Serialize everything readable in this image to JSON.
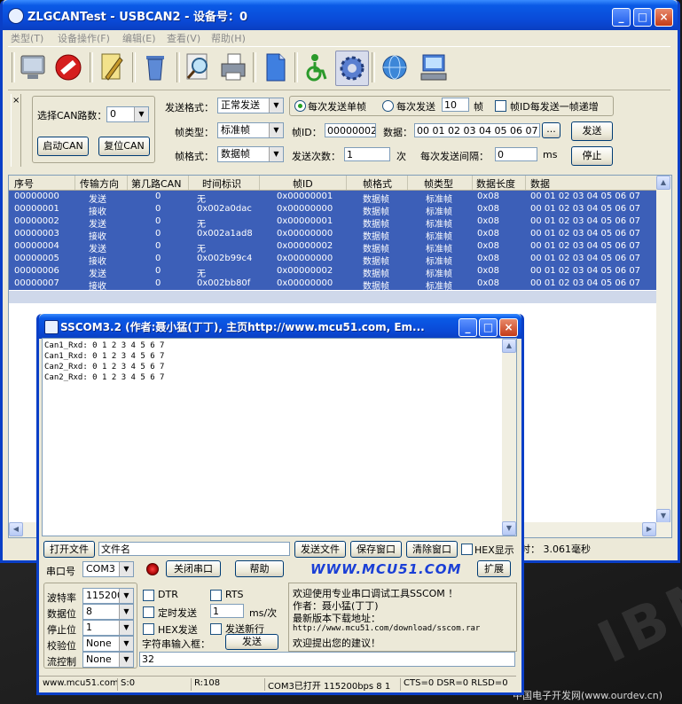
{
  "main_window": {
    "title": "ZLGCANTest - USBCAN2 - 设备号：0",
    "menu": [
      "类型(T)",
      "设备操作(F)",
      "编辑(E)",
      "查看(V)",
      "帮助(H)"
    ],
    "toolbar_icons": [
      "monitor-icon",
      "stop-icon",
      "pencil-icon",
      "trash-icon",
      "search-icon",
      "printer-icon",
      "document-icon",
      "accessibility-icon",
      "gear-icon",
      "globe-icon",
      "computer-icon"
    ],
    "panel": {
      "pin_label": "×",
      "channel_label": "选择CAN路数：",
      "channel_value": "0",
      "start_can": "启动CAN",
      "reset_can": "复位CAN",
      "send_format_label": "发送格式：",
      "send_format_value": "正常发送",
      "send_single_label": "每次发送单帧",
      "send_multi_label": "每次发送",
      "multi_count": "10",
      "frame_unit": "帧",
      "inc_id_label": "帧ID每发送一帧递增",
      "frame_type_label": "帧类型：",
      "frame_type_value": "标准帧",
      "frame_id_label": "帧ID：",
      "frame_id_value": "00000002",
      "data_label": "数据：",
      "data_value": "00 01 02 03 04 05 06 07",
      "ellipsis": "...",
      "send_button": "发送",
      "frame_format_label": "帧格式：",
      "frame_format_value": "数据帧",
      "send_count_label": "发送次数：",
      "send_count_value": "1",
      "times_unit": "次",
      "interval_label": "每次发送间隔：",
      "interval_value": "0",
      "ms_unit": "ms",
      "stop_button": "停止"
    },
    "grid": {
      "headers": [
        "序号",
        "传输方向",
        "第几路CAN",
        "时间标识",
        "帧ID",
        "帧格式",
        "帧类型",
        "数据长度",
        "数据"
      ],
      "rows": [
        [
          "00000000",
          "发送",
          "0",
          "无",
          "0x00000001",
          "数据帧",
          "标准帧",
          "0x08",
          "00 01 02 03 04 05 06 07"
        ],
        [
          "00000001",
          "接收",
          "0",
          "0x002a0dac",
          "0x00000000",
          "数据帧",
          "标准帧",
          "0x08",
          "00 01 02 03 04 05 06 07"
        ],
        [
          "00000002",
          "发送",
          "0",
          "无",
          "0x00000001",
          "数据帧",
          "标准帧",
          "0x08",
          "00 01 02 03 04 05 06 07"
        ],
        [
          "00000003",
          "接收",
          "0",
          "0x002a1ad8",
          "0x00000000",
          "数据帧",
          "标准帧",
          "0x08",
          "00 01 02 03 04 05 06 07"
        ],
        [
          "00000004",
          "发送",
          "0",
          "无",
          "0x00000002",
          "数据帧",
          "标准帧",
          "0x08",
          "00 01 02 03 04 05 06 07"
        ],
        [
          "00000005",
          "接收",
          "0",
          "0x002b99c4",
          "0x00000000",
          "数据帧",
          "标准帧",
          "0x08",
          "00 01 02 03 04 05 06 07"
        ],
        [
          "00000006",
          "发送",
          "0",
          "无",
          "0x00000002",
          "数据帧",
          "标准帧",
          "0x08",
          "00 01 02 03 04 05 06 07"
        ],
        [
          "00000007",
          "接收",
          "0",
          "0x002bb80f",
          "0x00000000",
          "数据帧",
          "标准帧",
          "0x08",
          "00 01 02 03 04 05 06 07"
        ]
      ]
    },
    "status_time": "时：  3.061毫秒"
  },
  "sscom": {
    "title": "SSCOM3.2 (作者:聂小猛(丁丁), 主页http://www.mcu51.com, Em...",
    "terminal_lines": [
      "Can1_Rxd: 0 1 2 3 4 5 6 7",
      "Can1_Rxd: 0 1 2 3 4 5 6 7",
      "Can2_Rxd: 0 1 2 3 4 5 6 7",
      "Can2_Rxd: 0 1 2 3 4 5 6 7"
    ],
    "open_file": "打开文件",
    "file_name": "文件名",
    "send_file": "发送文件",
    "save_window": "保存窗口",
    "clear_window": "清除窗口",
    "hex_display": "HEX显示",
    "port_label": "串口号",
    "port_value": "COM3",
    "close_port": "关闭串口",
    "help": "帮助",
    "brand": "WWW.MCU51.COM",
    "expand": "扩展",
    "baud_label": "波特率",
    "baud_value": "115200",
    "databits_label": "数据位",
    "databits_value": "8",
    "stopbits_label": "停止位",
    "stopbits_value": "1",
    "parity_label": "校验位",
    "parity_value": "None",
    "flow_label": "流控制",
    "flow_value": "None",
    "dtr": "DTR",
    "rts": "RTS",
    "timed_send": "定时发送",
    "interval_value": "1",
    "interval_unit": "ms/次",
    "hex_send": "HEX发送",
    "send_newline": "发送新行",
    "input_label": "字符串输入框：",
    "send_button": "发送",
    "input_value": "32",
    "info_lines": [
      "欢迎使用专业串口调试工具SSCOM ！",
      "作者：聂小猛(丁丁)",
      "最新版本下载地址：",
      "http://www.mcu51.com/download/sscom.rar",
      "欢迎提出您的建议！"
    ],
    "status": [
      "www.mcu51.com",
      "S:0",
      "R:108",
      "COM3已打开  115200bps  8 1",
      "CTS=0 DSR=0 RLSD=0"
    ]
  },
  "desktop": {
    "watermark": "中国电子开发网(www.ourdev.cn)",
    "logo_text": "IBM"
  }
}
